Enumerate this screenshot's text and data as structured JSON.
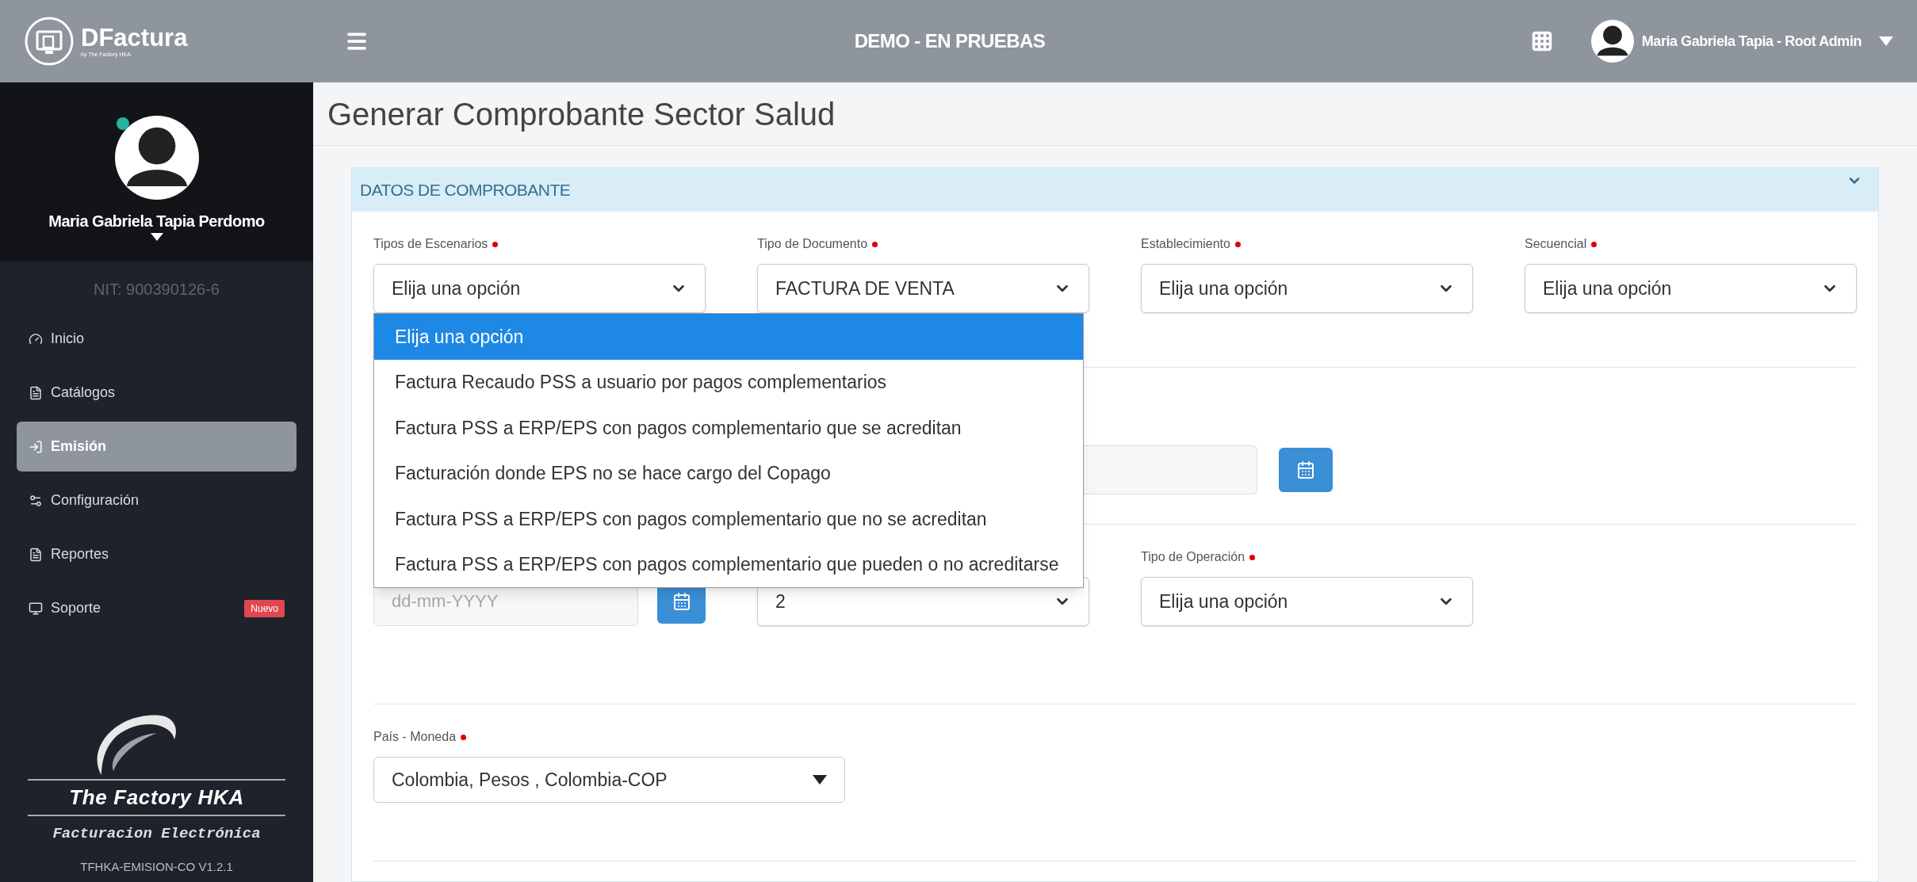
{
  "header": {
    "brand": "DFactura",
    "brand_sub": "by The Factory HKA",
    "environment": "DEMO - EN PRUEBAS",
    "user": "Maria Gabriela Tapia - Root Admin"
  },
  "sidebar": {
    "profile_name": "Maria Gabriela Tapia Perdomo",
    "online": true,
    "nit": "NIT: 900390126-6",
    "items": [
      {
        "label": "Inicio",
        "selected": false
      },
      {
        "label": "Catálogos",
        "selected": false
      },
      {
        "label": "Emisión",
        "selected": true
      },
      {
        "label": "Configuración",
        "selected": false
      },
      {
        "label": "Reportes",
        "selected": false
      },
      {
        "label": "Soporte",
        "selected": false,
        "badge": "Nuevo"
      }
    ],
    "logo_title": "The Factory HKA",
    "logo_subtitle": "Facturacion Electrónica",
    "version": "TFHKA-EMISION-CO V1.2.1"
  },
  "page_title": "Generar Comprobante Sector Salud",
  "panel": {
    "title": "DATOS DE COMPROBANTE",
    "expanded": true,
    "rows": [
      [
        {
          "kind": "select",
          "label": "Tipos de Escenarios",
          "required": true,
          "value": "Elija una opción"
        },
        {
          "kind": "select",
          "label": "Tipo de Documento",
          "required": true,
          "value": "FACTURA DE VENTA"
        },
        {
          "kind": "select",
          "label": "Establecimiento",
          "required": true,
          "value": "Elija una opción"
        },
        {
          "kind": "select",
          "label": "Secuencial",
          "required": true,
          "value": "Elija una opción"
        }
      ],
      [
        {
          "kind": "date_wide"
        }
      ],
      [
        {
          "kind": "date",
          "placeholder": "dd-mm-YYYY"
        },
        {
          "kind": "select",
          "value": "2"
        },
        {
          "kind": "select",
          "label": "Tipo de Operación",
          "required": true,
          "value": "Elija una opción"
        }
      ],
      [
        {
          "kind": "combo",
          "label": "País - Moneda",
          "required": true,
          "value": "Colombia, Pesos , Colombia-COP"
        }
      ]
    ]
  },
  "dropdown": {
    "options": [
      {
        "label": "Elija una opción",
        "selected": true
      },
      {
        "label": "Factura Recaudo PSS a usuario por pagos complementarios",
        "selected": false
      },
      {
        "label": "Factura PSS a ERP/EPS con pagos complementario que se acreditan",
        "selected": false
      },
      {
        "label": "Facturación donde EPS no se hace cargo del Copago",
        "selected": false
      },
      {
        "label": "Factura PSS a ERP/EPS con pagos complementario que no se acreditan",
        "selected": false
      },
      {
        "label": "Factura PSS a ERP/EPS con pagos complementario que pueden o no acreditarse",
        "selected": false
      }
    ]
  }
}
